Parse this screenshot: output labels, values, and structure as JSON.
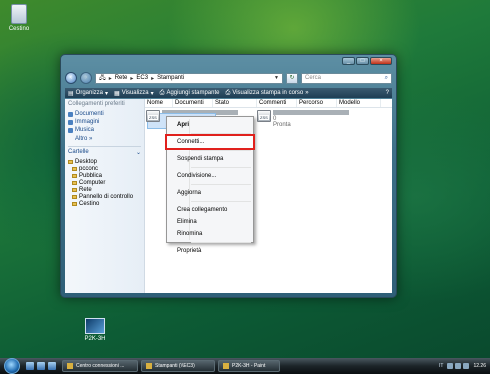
{
  "desktop": {
    "recycle_label": "Cestino",
    "p2_label": "P2K-3H"
  },
  "window": {
    "breadcrumb": [
      "Rete",
      "EC3",
      "Stampanti"
    ],
    "search_placeholder": "Cerca",
    "commands": [
      {
        "label": "Organizza",
        "icon": "organize-icon"
      },
      {
        "label": "Visualizza",
        "icon": "views-icon"
      },
      {
        "label": "Aggiungi stampante",
        "icon": "add-printer-icon"
      },
      {
        "label": "Visualizza stampa in corso",
        "icon": "print-queue-icon"
      }
    ],
    "nav": {
      "header": "Collegamenti preferiti",
      "links": [
        "Documenti",
        "Immagini",
        "Musica"
      ],
      "more": "Altro »",
      "folders_label": "Cartelle",
      "tree": [
        {
          "label": "Desktop",
          "level": 0
        },
        {
          "label": "pcconc",
          "level": 1
        },
        {
          "label": "Pubblica",
          "level": 1
        },
        {
          "label": "Computer",
          "level": 1
        },
        {
          "label": "Rete",
          "level": 1
        },
        {
          "label": "Pannello di controllo",
          "level": 1
        },
        {
          "label": "Cestino",
          "level": 1
        }
      ]
    },
    "columns": [
      "Nome",
      "Documenti",
      "Stato",
      "Commenti",
      "Percorso",
      "Modello"
    ],
    "printers": [
      {
        "badge": "ZSS",
        "status": ""
      },
      {
        "badge": "ZSS",
        "status_count": "0",
        "status": "Pronta"
      }
    ]
  },
  "context_menu": {
    "items": [
      {
        "label": "Apri",
        "bold": true
      },
      {
        "sep": true
      },
      {
        "label": "Connetti...",
        "highlight": true
      },
      {
        "sep": true
      },
      {
        "label": "Sospendi stampa"
      },
      {
        "sep": true
      },
      {
        "label": "Condivisione..."
      },
      {
        "sep": true
      },
      {
        "label": "Aggiorna"
      },
      {
        "sep": true
      },
      {
        "label": "Crea collegamento"
      },
      {
        "label": "Elimina"
      },
      {
        "label": "Rinomina"
      },
      {
        "sep": true
      },
      {
        "label": "Proprietà"
      }
    ]
  },
  "taskbar": {
    "buttons": [
      {
        "label": "Centro connessioni ..."
      },
      {
        "label": "Stampanti (\\\\EC3)"
      },
      {
        "label": "P2K-3H - Paint"
      }
    ],
    "lang": "IT",
    "clock": "12.26"
  },
  "colors": {
    "highlight_border": "#e0201c",
    "link": "#1a4a8a"
  }
}
